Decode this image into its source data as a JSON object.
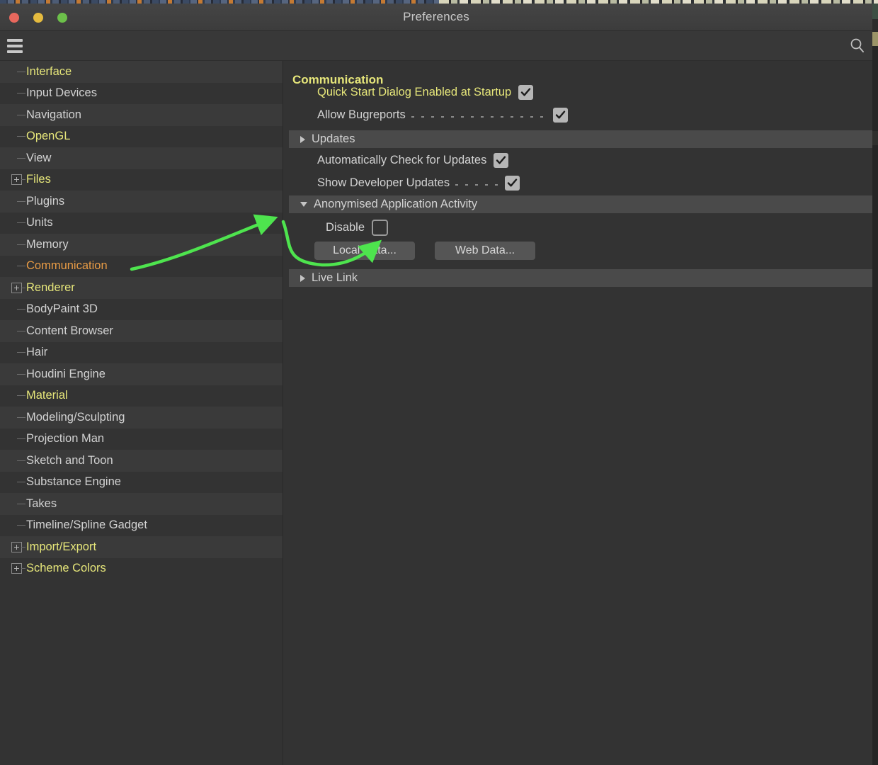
{
  "window": {
    "title": "Preferences",
    "traffic_lights": [
      {
        "name": "close",
        "color": "#e8685d"
      },
      {
        "name": "minimize",
        "color": "#e5bb3f"
      },
      {
        "name": "maximize",
        "color": "#6cc04a"
      }
    ]
  },
  "toolbar": {
    "menu_icon": "hamburger-icon",
    "search_icon": "search-icon"
  },
  "sidebar": {
    "items": [
      {
        "label": "Interface",
        "color": "yellow",
        "expandable": false
      },
      {
        "label": "Input Devices",
        "color": "grey",
        "expandable": false
      },
      {
        "label": "Navigation",
        "color": "grey",
        "expandable": false
      },
      {
        "label": "OpenGL",
        "color": "yellow",
        "expandable": false
      },
      {
        "label": "View",
        "color": "grey",
        "expandable": false
      },
      {
        "label": "Files",
        "color": "yellow",
        "expandable": true
      },
      {
        "label": "Plugins",
        "color": "grey",
        "expandable": false
      },
      {
        "label": "Units",
        "color": "grey",
        "expandable": false
      },
      {
        "label": "Memory",
        "color": "grey",
        "expandable": false
      },
      {
        "label": "Communication",
        "color": "orange",
        "expandable": false
      },
      {
        "label": "Renderer",
        "color": "yellow",
        "expandable": true
      },
      {
        "label": "BodyPaint 3D",
        "color": "grey",
        "expandable": false
      },
      {
        "label": "Content Browser",
        "color": "grey",
        "expandable": false
      },
      {
        "label": "Hair",
        "color": "grey",
        "expandable": false
      },
      {
        "label": "Houdini Engine",
        "color": "grey",
        "expandable": false
      },
      {
        "label": "Material",
        "color": "yellow",
        "expandable": false
      },
      {
        "label": "Modeling/Sculpting",
        "color": "grey",
        "expandable": false
      },
      {
        "label": "Projection Man",
        "color": "grey",
        "expandable": false
      },
      {
        "label": "Sketch and Toon",
        "color": "grey",
        "expandable": false
      },
      {
        "label": "Substance Engine",
        "color": "grey",
        "expandable": false
      },
      {
        "label": "Takes",
        "color": "grey",
        "expandable": false
      },
      {
        "label": "Timeline/Spline Gadget",
        "color": "grey",
        "expandable": false
      },
      {
        "label": "Import/Export",
        "color": "yellow",
        "expandable": true
      },
      {
        "label": "Scheme Colors",
        "color": "yellow",
        "expandable": true
      }
    ]
  },
  "main": {
    "panel_title": "Communication",
    "options": [
      {
        "label": "Quick Start Dialog Enabled at Startup",
        "checked": true,
        "highlight": true,
        "leader": false
      },
      {
        "label": "Allow Bugreports",
        "checked": true,
        "highlight": false,
        "leader": true
      },
      {
        "label": "Automatically Check for Updates",
        "checked": true,
        "highlight": false,
        "leader": false
      },
      {
        "label": "Show Developer Updates",
        "checked": true,
        "highlight": false,
        "leader": true
      },
      {
        "label": "Disable",
        "checked": false,
        "highlight": false,
        "leader": false
      }
    ],
    "sections": [
      {
        "label": "Updates",
        "expanded": false
      },
      {
        "label": "Anonymised Application Activity",
        "expanded": true
      },
      {
        "label": "Live Link",
        "expanded": false
      }
    ],
    "buttons": [
      {
        "label": "Local Data..."
      },
      {
        "label": "Web Data..."
      }
    ]
  },
  "annotation": {
    "color": "#4ee44e",
    "arrows": [
      {
        "name": "arrow-sidebar-to-section"
      },
      {
        "name": "arrow-section-to-disable-checkbox"
      }
    ]
  }
}
